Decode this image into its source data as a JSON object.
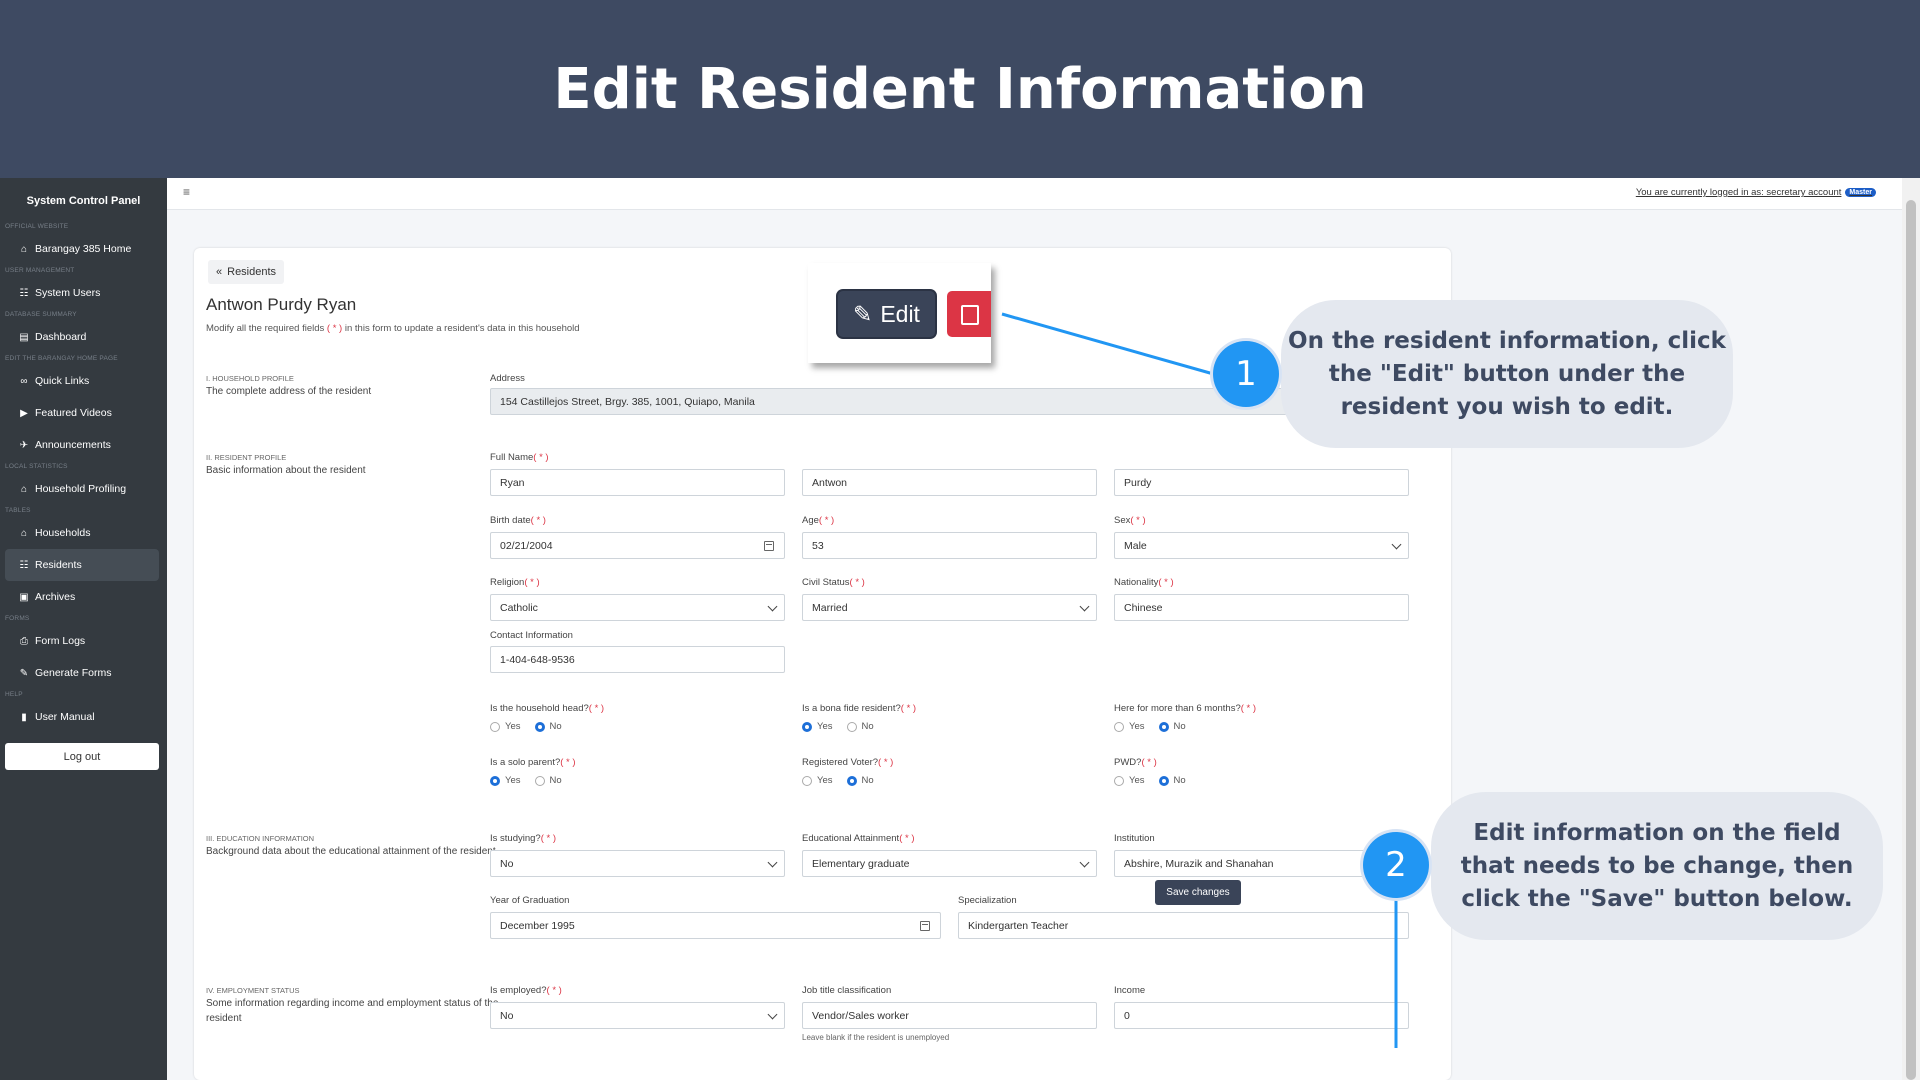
{
  "banner": {
    "title": "Edit Resident Information"
  },
  "sidebar": {
    "title": "System Control Panel",
    "sections": [
      {
        "header": "OFFICIAL WEBSITE",
        "items": [
          {
            "label": "Barangay 385 Home",
            "icon": "home-icon"
          }
        ]
      },
      {
        "header": "USER MANAGEMENT",
        "items": [
          {
            "label": "System Users",
            "icon": "users-icon"
          }
        ]
      },
      {
        "header": "DATABASE SUMMARY",
        "items": [
          {
            "label": "Dashboard",
            "icon": "chart-icon"
          }
        ]
      },
      {
        "header": "EDIT THE BARANGAY HOME PAGE",
        "items": [
          {
            "label": "Quick Links",
            "icon": "link-icon"
          },
          {
            "label": "Featured Videos",
            "icon": "video-icon"
          },
          {
            "label": "Announcements",
            "icon": "megaphone-icon"
          }
        ]
      },
      {
        "header": "LOCAL STATISTICS",
        "items": [
          {
            "label": "Household Profiling",
            "icon": "house-icon"
          }
        ]
      },
      {
        "header": "TABLES",
        "items": [
          {
            "label": "Households",
            "icon": "houses-icon"
          },
          {
            "label": "Residents",
            "icon": "residents-icon",
            "active": true
          },
          {
            "label": "Archives",
            "icon": "archive-icon"
          }
        ]
      },
      {
        "header": "FORMS",
        "items": [
          {
            "label": "Form Logs",
            "icon": "printer-icon"
          },
          {
            "label": "Generate Forms",
            "icon": "file-signature-icon"
          }
        ]
      },
      {
        "header": "HELP",
        "items": [
          {
            "label": "User Manual",
            "icon": "manual-icon"
          }
        ]
      }
    ],
    "logout": "Log out"
  },
  "topbar": {
    "menu_icon": "≡",
    "logged_in": "You are currently logged in as: secretary account",
    "badge": "Master"
  },
  "form": {
    "back": "Residents",
    "resident_name": "Antwon Purdy Ryan",
    "subtitle_pre": "Modify all the required fields ",
    "req": "( * )",
    "subtitle_post": " in this form to update a resident's data in this household",
    "s1": {
      "title": "I. HOUSEHOLD PROFILE",
      "desc": "The complete address of the resident",
      "address_label": "Address",
      "address": "154 Castillejos Street, Brgy. 385, 1001, Quiapo, Manila"
    },
    "s2": {
      "title": "II. RESIDENT PROFILE",
      "desc": "Basic information about the resident",
      "fullname_label": "Full Name",
      "last": "Ryan",
      "first": "Antwon",
      "middle": "Purdy",
      "birth_label": "Birth date",
      "birth": "02/21/2004",
      "age_label": "Age",
      "age": "53",
      "sex_label": "Sex",
      "sex": "Male",
      "religion_label": "Religion",
      "religion": "Catholic",
      "civil_label": "Civil Status",
      "civil": "Married",
      "nationality_label": "Nationality",
      "nationality": "Chinese",
      "contact_label": "Contact Information",
      "contact": "1-404-648-9536",
      "q_head": "Is the household head?",
      "q_bona": "Is a bona fide resident?",
      "q_six": "Here for more than 6 months?",
      "q_solo": "Is a solo parent?",
      "q_voter": "Registered Voter?",
      "q_pwd": "PWD?",
      "yes": "Yes",
      "no": "No"
    },
    "s3": {
      "title": "III. EDUCATION INFORMATION",
      "desc": "Background data about the educational attainment of the resident",
      "studying_label": "Is studying?",
      "studying": "No",
      "attain_label": "Educational Attainment",
      "attain": "Elementary graduate",
      "inst_label": "Institution",
      "inst": "Abshire, Murazik and Shanahan",
      "grad_label": "Year of Graduation",
      "grad": "December 1995",
      "spec_label": "Specialization",
      "spec": "Kindergarten Teacher"
    },
    "s4": {
      "title": "IV. EMPLOYMENT STATUS",
      "desc": "Some information regarding income and employment status of the resident",
      "employed_label": "Is employed?",
      "employed": "No",
      "job_label": "Job title classification",
      "job": "Vendor/Sales worker",
      "job_hint": "Leave blank if the resident is unemployed",
      "income_label": "Income",
      "income": "0"
    },
    "save": "Save changes"
  },
  "callouts": {
    "edit_button": "Edit",
    "c1_num": "1",
    "c1": "On the resident information, click the \"Edit\" button under the resident you wish to edit.",
    "c2_num": "2",
    "c2": "Edit information on the field that needs to be change, then click the \"Save\" button below.",
    "color": "#2196f3"
  }
}
